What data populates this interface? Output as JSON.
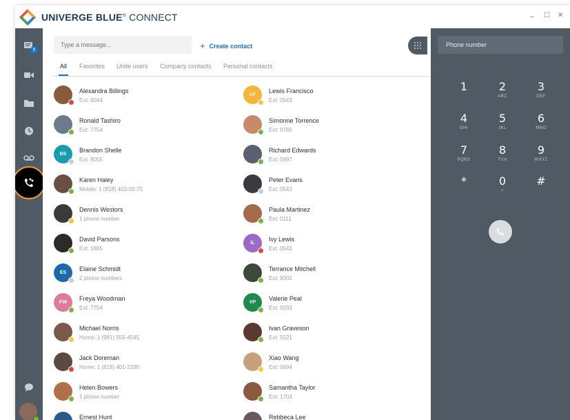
{
  "app": {
    "brand_bold": "UNIVERGE BLUE",
    "brand_reg": "®",
    "brand_light": " CONNECT"
  },
  "window_controls": {
    "minimize": "–",
    "maximize": "☐",
    "close": "✕"
  },
  "sidebar": {
    "chat_badge": "5"
  },
  "search": {
    "placeholder": "Type a message..."
  },
  "create_contact": {
    "icon": "+",
    "label": "Create contact"
  },
  "tabs": [
    "All",
    "Favorites",
    "Unite users",
    "Company contacts",
    "Personal contacts"
  ],
  "contacts_left": [
    {
      "name": "Alexandra Billings",
      "detail": "Ext: 6044",
      "initials": "",
      "color": "#8a5a3c",
      "status": "#e0463a"
    },
    {
      "name": "Ronald Tashiro",
      "detail": "Ext: 7754",
      "initials": "",
      "color": "#6b7b8c",
      "status": "#7cb342"
    },
    {
      "name": "Brandon Shelle",
      "detail": "Ext: 8055",
      "initials": "BS",
      "color": "#1a9bb0",
      "status": "#c9ced2"
    },
    {
      "name": "Karen Haley",
      "detail": "Mobile: 1 (818) 403-02-75",
      "initials": "",
      "color": "#6a5040",
      "status": "#7cb342"
    },
    {
      "name": "Dennis Westors",
      "detail": "1 phone number",
      "initials": "",
      "color": "#3a3a3a",
      "status": "#f2c744"
    },
    {
      "name": "David Parsons",
      "detail": "Ext: 1885",
      "initials": "",
      "color": "#2d2a28",
      "status": "#7cb342"
    },
    {
      "name": "Elaine Schmidt",
      "detail": "2 phone numbers",
      "initials": "ES",
      "color": "#1d6aa8",
      "status": "#c9ced2"
    },
    {
      "name": "Freya Woodman",
      "detail": "Ext: 7754",
      "initials": "FW",
      "color": "#e07a9a",
      "status": "#7cb342"
    },
    {
      "name": "Michael Norris",
      "detail": "Home: 1 (981) 555-4545",
      "initials": "",
      "color": "#7a5a48",
      "status": "#f2c744"
    },
    {
      "name": "Jack Doreman",
      "detail": "Home: 1 (818) 401-2290",
      "initials": "",
      "color": "#5a4a42",
      "status": "#e0463a"
    },
    {
      "name": "Helen Bowers",
      "detail": "1 phone number",
      "initials": "",
      "color": "#b0704a",
      "status": "#7cb342"
    },
    {
      "name": "Ernest Hunt",
      "detail": "",
      "initials": "",
      "color": "#2a5a8c",
      "status": ""
    }
  ],
  "contacts_right": [
    {
      "name": "Lewis Francisco",
      "detail": "Ext: 0543",
      "initials": "LF",
      "color": "#f3b53b",
      "status": "#f2c744"
    },
    {
      "name": "Simonne Torrence",
      "detail": "Ext: 9765",
      "initials": "",
      "color": "#c98a6a",
      "status": "#7cb342"
    },
    {
      "name": "Richard Edwards",
      "detail": "Ext: 0997",
      "initials": "",
      "color": "#5a6070",
      "status": "#7cb342"
    },
    {
      "name": "Peter Evans",
      "detail": "Ext: 0543",
      "initials": "",
      "color": "#3a3a40",
      "status": "#c9ced2"
    },
    {
      "name": "Paula Martinez",
      "detail": "Ext: 0111",
      "initials": "",
      "color": "#a56a4a",
      "status": "#7cb342"
    },
    {
      "name": "Ivy Lewis",
      "detail": "Ext: 0543",
      "initials": "IL",
      "color": "#9a6ac8",
      "status": "#e0463a"
    },
    {
      "name": "Terrance Mitchell",
      "detail": "Ext: 9002",
      "initials": "",
      "color": "#3d4a3a",
      "status": "#7cb342"
    },
    {
      "name": "Valerie Peal",
      "detail": "Ext: 5033",
      "initials": "VP",
      "color": "#1f8a4c",
      "status": "#7cb342"
    },
    {
      "name": "Ivan Graveson",
      "detail": "Ext: 5021",
      "initials": "",
      "color": "#5a3a30",
      "status": "#7cb342"
    },
    {
      "name": "Xiao Wang",
      "detail": "Ext: 0694",
      "initials": "",
      "color": "#c8a07a",
      "status": "#f2c744"
    },
    {
      "name": "Samantha Taylor",
      "detail": "Ext: 1703",
      "initials": "",
      "color": "#8a5a40",
      "status": "#7cb342"
    },
    {
      "name": "Rebbeca Lee",
      "detail": "",
      "initials": "",
      "color": "#6a5a60",
      "status": ""
    }
  ],
  "dialer": {
    "placeholder": "Phone number",
    "keys": [
      {
        "d": "1",
        "l": ""
      },
      {
        "d": "2",
        "l": "ABC"
      },
      {
        "d": "3",
        "l": "DEF"
      },
      {
        "d": "4",
        "l": "GHI"
      },
      {
        "d": "5",
        "l": "JKL"
      },
      {
        "d": "6",
        "l": "MNO"
      },
      {
        "d": "7",
        "l": "PQRS"
      },
      {
        "d": "8",
        "l": "TUV"
      },
      {
        "d": "9",
        "l": "WXYZ"
      },
      {
        "d": "*",
        "l": ""
      },
      {
        "d": "0",
        "l": "+"
      },
      {
        "d": "#",
        "l": ""
      }
    ]
  },
  "colors": {
    "accent": "#1773c8",
    "sidebar": "#4f5a64",
    "highlight_ring": "#f39c1f"
  }
}
